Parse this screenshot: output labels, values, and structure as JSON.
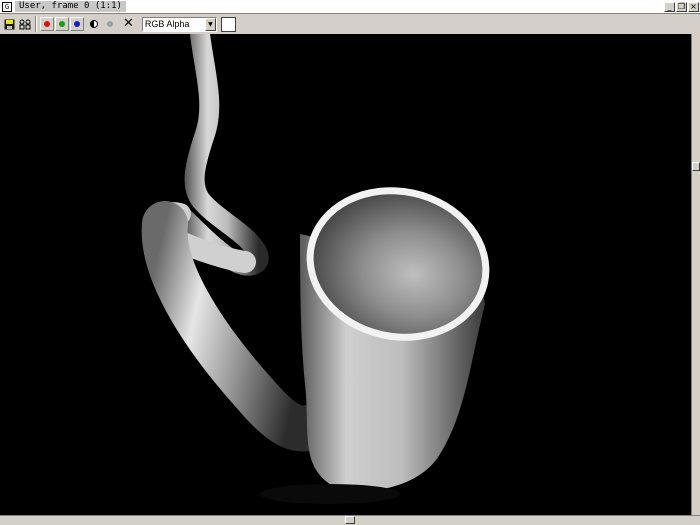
{
  "window": {
    "title": "User, frame 0 (1:1)",
    "app_icon": "render-frame-icon",
    "buttons": [
      {
        "name": "minimize-button",
        "glyph": "_"
      },
      {
        "name": "restore-button",
        "glyph": "❐"
      },
      {
        "name": "close-button",
        "glyph": "×"
      }
    ]
  },
  "toolbar": {
    "save_icon": "save-icon",
    "clone_icon": "clone-icon",
    "channels": [
      {
        "name": "red-channel-button",
        "color": "#e01010"
      },
      {
        "name": "green-channel-button",
        "color": "#10a010"
      },
      {
        "name": "blue-channel-button",
        "color": "#1020d0"
      }
    ],
    "mono_icon": "monochrome-icon",
    "alpha_icon": "alpha-channel-icon",
    "clear_glyph": "✕",
    "display_channel": "RGB Alpha",
    "swatch_color": "#ffffff"
  },
  "viewport": {
    "background": "#000000",
    "subject": "rendered tube object"
  }
}
